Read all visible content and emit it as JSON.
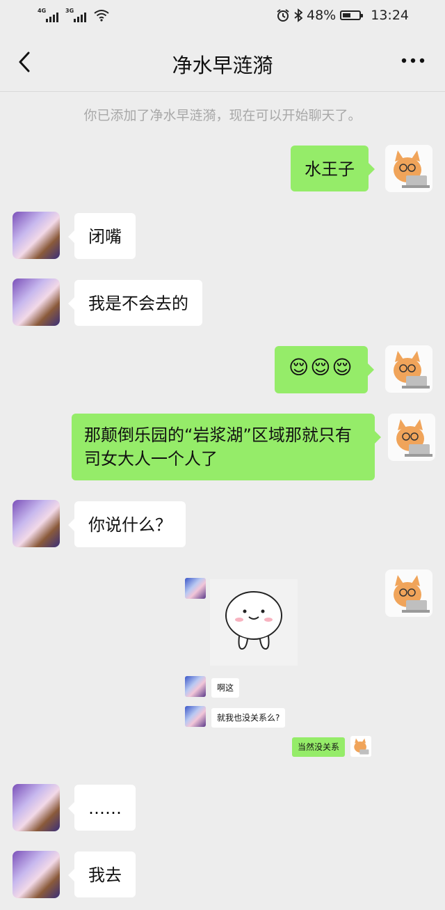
{
  "status_bar": {
    "net1": "4G",
    "net2": "3G",
    "battery_pct": "48%",
    "battery_level": 0.48,
    "time": "13:24"
  },
  "header": {
    "title": "净水早涟漪"
  },
  "system_message": "你已添加了净水早涟漪，现在可以开始聊天了。",
  "messages": [
    {
      "side": "out",
      "text": "水王子"
    },
    {
      "side": "in",
      "text": "闭嘴"
    },
    {
      "side": "in",
      "text": "我是不会去的"
    },
    {
      "side": "out",
      "text": "😌😌😌"
    },
    {
      "side": "out",
      "text": "那颠倒乐园的“岩浆湖”区域那就只有司女大人一个人了"
    },
    {
      "side": "in",
      "text": "你说什么？"
    },
    {
      "side": "out",
      "type": "image",
      "embedded": {
        "msg1": "啊这",
        "msg2": "就我也没关系么?",
        "msg3": "当然没关系"
      }
    },
    {
      "side": "in",
      "text": "……"
    },
    {
      "side": "in",
      "text": "我去"
    }
  ],
  "icons": {
    "back": "chevron-left-icon",
    "more": "ellipsis-icon",
    "alarm": "alarm-icon",
    "bluetooth": "bluetooth-icon",
    "wifi": "wifi-icon",
    "battery": "battery-icon"
  },
  "colors": {
    "background": "#ededed",
    "outgoing_bubble": "#95ec69",
    "incoming_bubble": "#ffffff"
  }
}
